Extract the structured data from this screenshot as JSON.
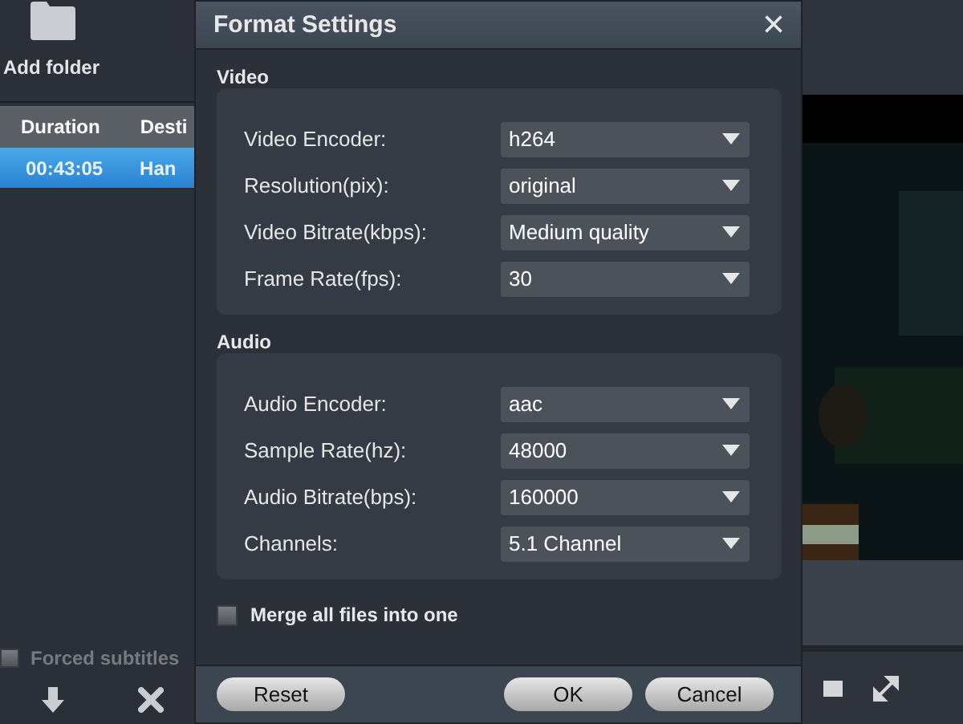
{
  "toolbar": {
    "add_folder": "Add folder"
  },
  "table": {
    "columns": [
      "Duration",
      "Desti"
    ],
    "rows": [
      {
        "cells": [
          "00:43:05",
          "Han"
        ],
        "selected": true
      }
    ]
  },
  "forced_subtitles": {
    "label": "Forced subtitles",
    "checked": false
  },
  "dialog": {
    "title": "Format Settings",
    "close": "×",
    "groups": [
      {
        "title": "Video",
        "settings": [
          {
            "label": "Video Encoder:",
            "value": "h264"
          },
          {
            "label": "Resolution(pix):",
            "value": "original"
          },
          {
            "label": "Video Bitrate(kbps):",
            "value": "Medium quality"
          },
          {
            "label": "Frame Rate(fps):",
            "value": "30"
          }
        ]
      },
      {
        "title": "Audio",
        "settings": [
          {
            "label": "Audio Encoder:",
            "value": "aac"
          },
          {
            "label": "Sample Rate(hz):",
            "value": "48000"
          },
          {
            "label": "Audio Bitrate(bps):",
            "value": "160000"
          },
          {
            "label": "Channels:",
            "value": "5.1 Channel"
          }
        ]
      }
    ],
    "merge": {
      "label": "Merge all files into one",
      "checked": false
    },
    "buttons": {
      "reset": "Reset",
      "ok": "OK",
      "cancel": "Cancel"
    }
  }
}
